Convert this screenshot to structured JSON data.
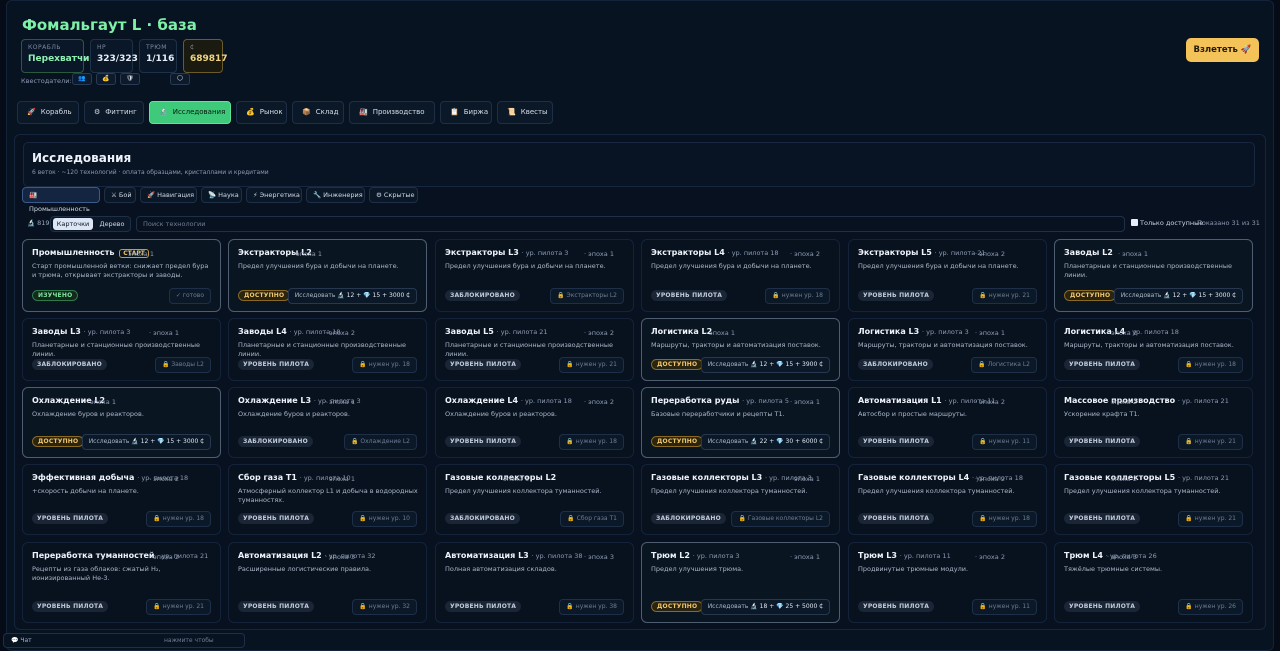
{
  "header": {
    "title": "Фомальгаут L · база",
    "ship_label": "КОРАБЛЬ",
    "ship_value": "Перехватчик",
    "hp_label": "HP",
    "hp_value": "323/323",
    "hold_label": "ТРЮМ",
    "hold_value": "1/116",
    "credits_label": "₵",
    "credits_value": "689817",
    "questgivers_label": "Квестодатели:",
    "questgivers": [
      "👥",
      "💰",
      "🛡",
      "🌕"
    ],
    "launch_label": "Взлететь 🚀"
  },
  "tabs": [
    {
      "icon": "🚀",
      "label": "Корабль"
    },
    {
      "icon": "⚙",
      "label": "Фиттинг"
    },
    {
      "icon": "🔬",
      "label": "Исследования"
    },
    {
      "icon": "💰",
      "label": "Рынок"
    },
    {
      "icon": "📦",
      "label": "Склад"
    },
    {
      "icon": "🏭",
      "label": "Производство"
    },
    {
      "icon": "📋",
      "label": "Биржа"
    },
    {
      "icon": "📜",
      "label": "Квесты"
    }
  ],
  "research": {
    "title": "Исследования",
    "subtitle": "6 веток · ~120 технологий · оплата образцами, кристаллами и кредитами",
    "branches": [
      "🏭 Промышленность",
      "⚔ Бой",
      "🚀 Навигация",
      "📡 Наука",
      "⚡ Энергетика",
      "🔧 Инженерия",
      "⚙ Скрытые"
    ],
    "count": "🔬 819",
    "view_cards": "Карточки",
    "view_tree": "Дерево",
    "search_placeholder": "Поиск технологии",
    "only_available": "Только доступные",
    "shown": "Показано 31 из 31"
  },
  "cards": [
    {
      "name": "Промышленность",
      "start": "СТАРТ",
      "pilot": "",
      "epoch": "· эпоха 1",
      "desc": "Старт промышленной ветки: снижает предел бура и трюма, открывает экстракторы и заводы.",
      "status": "done",
      "badge": "ИЗУЧЕНО",
      "action": "✓ готово"
    },
    {
      "name": "Экстракторы L2",
      "start": "",
      "pilot": "",
      "epoch": "· эпоха 1",
      "desc": "Предел улучшения бура и добычи на планете.",
      "status": "avail",
      "badge": "ДОСТУПНО",
      "action": "Исследовать",
      "cost": "🔬 12 + 💎 15 + 3000 ₵"
    },
    {
      "name": "Экстракторы L3",
      "start": "",
      "pilot": "· ур. пилота 3",
      "epoch": "· эпоха 1",
      "desc": "Предел улучшения бура и добычи на планете.",
      "status": "lock",
      "badge": "ЗАБЛОКИРОВАНО",
      "action": "🔒 Экстракторы L2"
    },
    {
      "name": "Экстракторы L4",
      "start": "",
      "pilot": "· ур. пилота 18",
      "epoch": "· эпоха 2",
      "desc": "Предел улучшения бура и добычи на планете.",
      "status": "pilot",
      "badge": "УРОВЕНЬ ПИЛОТА",
      "action": "🔒 нужен ур. 18"
    },
    {
      "name": "Экстракторы L5",
      "start": "",
      "pilot": "· ур. пилота 21",
      "epoch": "· эпоха 2",
      "desc": "Предел улучшения бура и добычи на планете.",
      "status": "pilot",
      "badge": "УРОВЕНЬ ПИЛОТА",
      "action": "🔒 нужен ур. 21"
    },
    {
      "name": "Заводы L2",
      "start": "",
      "pilot": "",
      "epoch": "· эпоха 1",
      "desc": "Планетарные и станционные производственные линии.",
      "status": "avail",
      "badge": "ДОСТУПНО",
      "action": "Исследовать",
      "cost": "🔬 12 + 💎 15 + 3000 ₵"
    },
    {
      "name": "Заводы L3",
      "start": "",
      "pilot": "· ур. пилота 3",
      "epoch": "· эпоха 1",
      "desc": "Планетарные и станционные производственные линии.",
      "status": "lock",
      "badge": "ЗАБЛОКИРОВАНО",
      "action": "🔒 Заводы L2"
    },
    {
      "name": "Заводы L4",
      "start": "",
      "pilot": "· ур. пилота 18",
      "epoch": "· эпоха 2",
      "desc": "Планетарные и станционные производственные линии.",
      "status": "pilot",
      "badge": "УРОВЕНЬ ПИЛОТА",
      "action": "🔒 нужен ур. 18"
    },
    {
      "name": "Заводы L5",
      "start": "",
      "pilot": "· ур. пилота 21",
      "epoch": "· эпоха 2",
      "desc": "Планетарные и станционные производственные линии.",
      "status": "pilot",
      "badge": "УРОВЕНЬ ПИЛОТА",
      "action": "🔒 нужен ур. 21"
    },
    {
      "name": "Логистика L2",
      "start": "",
      "pilot": "",
      "epoch": "· эпоха 1",
      "desc": "Маршруты, тракторы и автоматизация поставок.",
      "status": "avail",
      "badge": "ДОСТУПНО",
      "action": "Исследовать",
      "cost": "🔬 12 + 💎 15 + 3900 ₵"
    },
    {
      "name": "Логистика L3",
      "start": "",
      "pilot": "· ур. пилота 3",
      "epoch": "· эпоха 1",
      "desc": "Маршруты, тракторы и автоматизация поставок.",
      "status": "lock",
      "badge": "ЗАБЛОКИРОВАНО",
      "action": "🔒 Логистика L2"
    },
    {
      "name": "Логистика L4",
      "start": "",
      "pilot": "· ур. пилота 18",
      "epoch": "· эпоха 2",
      "desc": "Маршруты, тракторы и автоматизация поставок.",
      "status": "pilot",
      "badge": "УРОВЕНЬ ПИЛОТА",
      "action": "🔒 нужен ур. 18"
    },
    {
      "name": "Охлаждение L2",
      "start": "",
      "pilot": "",
      "epoch": "· эпоха 1",
      "desc": "Охлаждение буров и реакторов.",
      "status": "avail",
      "badge": "ДОСТУПНО",
      "action": "Исследовать",
      "cost": "🔬 12 + 💎 15 + 3000 ₵"
    },
    {
      "name": "Охлаждение L3",
      "start": "",
      "pilot": "· ур. пилота 3",
      "epoch": "· эпоха 1",
      "desc": "Охлаждение буров и реакторов.",
      "status": "lock",
      "badge": "ЗАБЛОКИРОВАНО",
      "action": "🔒 Охлаждение L2"
    },
    {
      "name": "Охлаждение L4",
      "start": "",
      "pilot": "· ур. пилота 18",
      "epoch": "· эпоха 2",
      "desc": "Охлаждение буров и реакторов.",
      "status": "pilot",
      "badge": "УРОВЕНЬ ПИЛОТА",
      "action": "🔒 нужен ур. 18"
    },
    {
      "name": "Переработка руды",
      "start": "",
      "pilot": "· ур. пилота 5",
      "epoch": "· эпоха 1",
      "desc": "Базовые переработчики и рецепты Т1.",
      "status": "avail",
      "badge": "ДОСТУПНО",
      "action": "Исследовать",
      "cost": "🔬 22 + 💎 30 + 6000 ₵"
    },
    {
      "name": "Автоматизация L1",
      "start": "",
      "pilot": "· ур. пилота 11",
      "epoch": "· эпоха 2",
      "desc": "Автосбор и простые маршруты.",
      "status": "pilot",
      "badge": "УРОВЕНЬ ПИЛОТА",
      "action": "🔒 нужен ур. 11"
    },
    {
      "name": "Массовое производство",
      "start": "",
      "pilot": "· ур. пилота 21",
      "epoch": "· эпоха 2",
      "desc": "Ускорение крафта Т1.",
      "status": "pilot",
      "badge": "УРОВЕНЬ ПИЛОТА",
      "action": "🔒 нужен ур. 21"
    },
    {
      "name": "Эффективная добыча",
      "start": "",
      "pilot": "· ур. пилота 18",
      "epoch": "· эпоха 2",
      "desc": "+скорость добычи на планете.",
      "status": "pilot",
      "badge": "УРОВЕНЬ ПИЛОТА",
      "action": "🔒 нужен ур. 18"
    },
    {
      "name": "Сбор газа T1",
      "start": "",
      "pilot": "· ур. пилота 10",
      "epoch": "· эпоха 1",
      "desc": "Атмосферный коллектор L1 и добыча в водородных туманностях.",
      "status": "pilot",
      "badge": "УРОВЕНЬ ПИЛОТА",
      "action": "🔒 нужен ур. 10"
    },
    {
      "name": "Газовые коллекторы L2",
      "start": "",
      "pilot": "",
      "epoch": "· эпоха 1",
      "desc": "Предел улучшения коллектора туманностей.",
      "status": "lock",
      "badge": "ЗАБЛОКИРОВАНО",
      "action": "🔒 Сбор газа T1"
    },
    {
      "name": "Газовые коллекторы L3",
      "start": "",
      "pilot": "· ур. пилота 3",
      "epoch": "· эпоха 1",
      "desc": "Предел улучшения коллектора туманностей.",
      "status": "lock",
      "badge": "ЗАБЛОКИРОВАНО",
      "action": "🔒 Газовые коллекторы L2"
    },
    {
      "name": "Газовые коллекторы L4",
      "start": "",
      "pilot": "· ур. пилота 18",
      "epoch": "· эпоха 2",
      "desc": "Предел улучшения коллектора туманностей.",
      "status": "pilot",
      "badge": "УРОВЕНЬ ПИЛОТА",
      "action": "🔒 нужен ур. 18"
    },
    {
      "name": "Газовые коллекторы L5",
      "start": "",
      "pilot": "· ур. пилота 21",
      "epoch": "· эпоха 2",
      "desc": "Предел улучшения коллектора туманностей.",
      "status": "pilot",
      "badge": "УРОВЕНЬ ПИЛОТА",
      "action": "🔒 нужен ур. 21"
    },
    {
      "name": "Переработка туманностей",
      "start": "",
      "pilot": "· ур. пилота 21",
      "epoch": "· эпоха 2",
      "desc": "Рецепты из газа облаков: сжатый H₂, ионизированный Не-3.",
      "status": "pilot",
      "badge": "УРОВЕНЬ ПИЛОТА",
      "action": "🔒 нужен ур. 21"
    },
    {
      "name": "Автоматизация L2",
      "start": "",
      "pilot": "· ур. пилота 32",
      "epoch": "· эпоха 3",
      "desc": "Расширенные логистические правила.",
      "status": "pilot",
      "badge": "УРОВЕНЬ ПИЛОТА",
      "action": "🔒 нужен ур. 32"
    },
    {
      "name": "Автоматизация L3",
      "start": "",
      "pilot": "· ур. пилота 38",
      "epoch": "· эпоха 3",
      "desc": "Полная автоматизация складов.",
      "status": "pilot",
      "badge": "УРОВЕНЬ ПИЛОТА",
      "action": "🔒 нужен ур. 38"
    },
    {
      "name": "Трюм L2",
      "start": "",
      "pilot": "· ур. пилота 3",
      "epoch": "· эпоха 1",
      "desc": "Предел улучшения трюма.",
      "status": "avail",
      "badge": "ДОСТУПНО",
      "action": "Исследовать",
      "cost": "🔬 18 + 💎 25 + 5000 ₵"
    },
    {
      "name": "Трюм L3",
      "start": "",
      "pilot": "· ур. пилота 11",
      "epoch": "· эпоха 2",
      "desc": "Продвинутые трюмные модули.",
      "status": "pilot",
      "badge": "УРОВЕНЬ ПИЛОТА",
      "action": "🔒 нужен ур. 11"
    },
    {
      "name": "Трюм L4",
      "start": "",
      "pilot": "· ур. пилота 26",
      "epoch": "· эпоха 3",
      "desc": "Тяжёлые трюмные системы.",
      "status": "pilot",
      "badge": "УРОВЕНЬ ПИЛОТА",
      "action": "🔒 нужен ур. 26"
    }
  ],
  "chat": {
    "label": "💬 Чат",
    "hint": "нажмите чтобы развернуть"
  }
}
